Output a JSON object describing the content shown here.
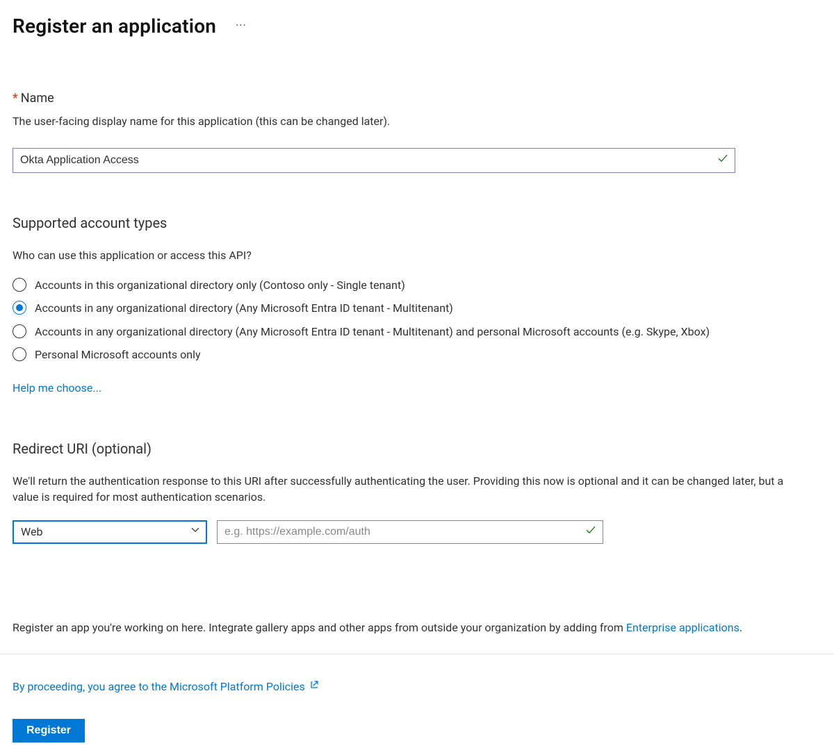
{
  "header": {
    "title": "Register an application"
  },
  "name_section": {
    "label": "Name",
    "description": "The user-facing display name for this application (this can be changed later).",
    "value": "Okta Application Access"
  },
  "account_types": {
    "heading": "Supported account types",
    "question": "Who can use this application or access this API?",
    "options": [
      "Accounts in this organizational directory only (Contoso only - Single tenant)",
      "Accounts in any organizational directory (Any Microsoft Entra ID tenant - Multitenant)",
      "Accounts in any organizational directory (Any Microsoft Entra ID tenant - Multitenant) and personal Microsoft accounts (e.g. Skype, Xbox)",
      "Personal Microsoft accounts only"
    ],
    "selected_index": 1,
    "help_link": "Help me choose..."
  },
  "redirect": {
    "heading": "Redirect URI (optional)",
    "description": "We'll return the authentication response to this URI after successfully authenticating the user. Providing this now is optional and it can be changed later, but a value is required for most authentication scenarios.",
    "platform_selected": "Web",
    "uri_placeholder": "e.g. https://example.com/auth"
  },
  "footer": {
    "enterprise_text_prefix": "Register an app you're working on here. Integrate gallery apps and other apps from outside your organization by adding from ",
    "enterprise_link": "Enterprise applications",
    "policies_text": "By proceeding, you agree to the Microsoft Platform Policies",
    "register_button": "Register"
  }
}
